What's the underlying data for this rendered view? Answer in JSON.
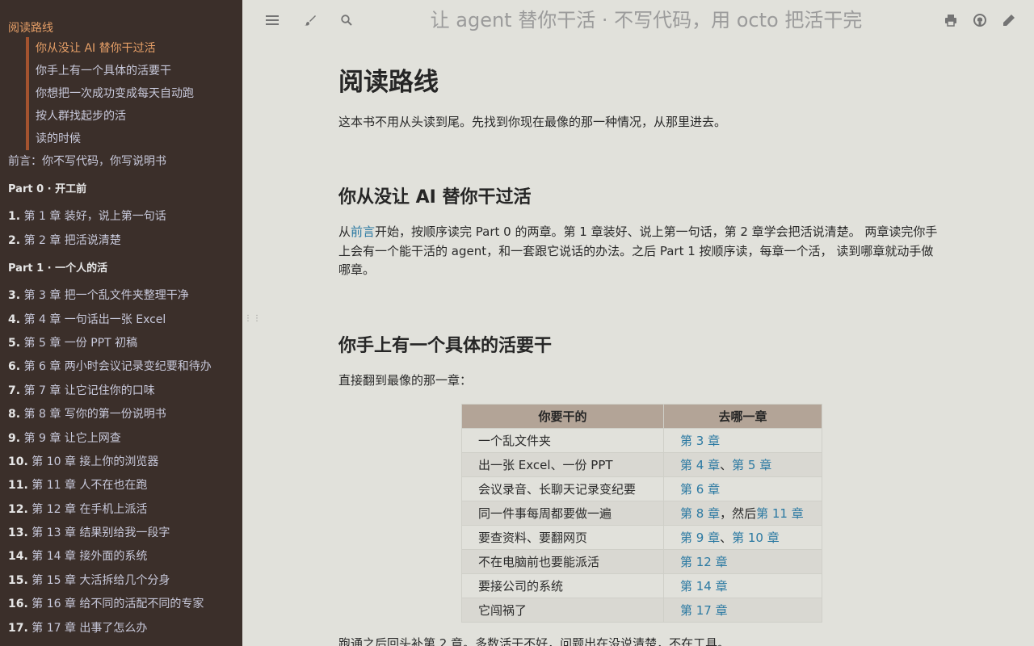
{
  "sidebar": {
    "active_label": "阅读路线",
    "sub_items": [
      "你从没让 AI 替你干过活",
      "你手上有一个具体的活要干",
      "你想把一次成功变成每天自动跑",
      "按人群找起步的活",
      "读的时候"
    ],
    "preface": "前言：你不写代码，你写说明书",
    "part0": "Part 0 · 开工前",
    "chapters_a": [
      {
        "num": "1.",
        "title": "第 1 章 装好，说上第一句话"
      },
      {
        "num": "2.",
        "title": "第 2 章 把活说清楚"
      }
    ],
    "part1": "Part 1 · 一个人的活",
    "chapters_b": [
      {
        "num": "3.",
        "title": "第 3 章 把一个乱文件夹整理干净"
      },
      {
        "num": "4.",
        "title": "第 4 章 一句话出一张 Excel"
      },
      {
        "num": "5.",
        "title": "第 5 章 一份 PPT 初稿"
      },
      {
        "num": "6.",
        "title": "第 6 章 两小时会议记录变纪要和待办"
      },
      {
        "num": "7.",
        "title": "第 7 章 让它记住你的口味"
      },
      {
        "num": "8.",
        "title": "第 8 章 写你的第一份说明书"
      },
      {
        "num": "9.",
        "title": "第 9 章 让它上网查"
      },
      {
        "num": "10.",
        "title": "第 10 章 接上你的浏览器"
      },
      {
        "num": "11.",
        "title": "第 11 章 人不在也在跑"
      },
      {
        "num": "12.",
        "title": "第 12 章 在手机上派活"
      },
      {
        "num": "13.",
        "title": "第 13 章 结果别给我一段字"
      },
      {
        "num": "14.",
        "title": "第 14 章 接外面的系统"
      },
      {
        "num": "15.",
        "title": "第 15 章 大活拆给几个分身"
      },
      {
        "num": "16.",
        "title": "第 16 章 给不同的活配不同的专家"
      },
      {
        "num": "17.",
        "title": "第 17 章 出事了怎么办"
      }
    ]
  },
  "topbar": {
    "title": "让 agent 替你干活 · 不写代码，用 octo 把活干完"
  },
  "content": {
    "h1": "阅读路线",
    "intro": "这本书不用从头读到尾。先找到你现在最像的那一种情况，从那里进去。",
    "sec1_title": "你从没让 AI 替你干过活",
    "sec1_p_pre": "从",
    "sec1_p_link": "前言",
    "sec1_p_post": "开始，按顺序读完 Part 0 的两章。第 1 章装好、说上第一句话，第 2 章学会把活说清楚。 两章读完你手上会有一个能干活的 agent，和一套跟它说话的办法。之后 Part 1 按顺序读，每章一个活， 读到哪章就动手做哪章。",
    "sec2_title": "你手上有一个具体的活要干",
    "sec2_p": "直接翻到最像的那一章：",
    "table": {
      "headers": [
        "你要干的",
        "去哪一章"
      ],
      "rows": [
        {
          "task": "一个乱文件夹",
          "links": [
            "第 3 章"
          ],
          "sep": [],
          "tail": ""
        },
        {
          "task": "出一张 Excel、一份 PPT",
          "links": [
            "第 4 章",
            "第 5 章"
          ],
          "sep": [
            "、"
          ],
          "tail": ""
        },
        {
          "task": "会议录音、长聊天记录变纪要",
          "links": [
            "第 6 章"
          ],
          "sep": [],
          "tail": ""
        },
        {
          "task": "同一件事每周都要做一遍",
          "links": [
            "第 8 章",
            "第 11 章"
          ],
          "sep": [
            "，然后"
          ],
          "tail": ""
        },
        {
          "task": "要查资料、要翻网页",
          "links": [
            "第 9 章",
            "第 10 章"
          ],
          "sep": [
            "、"
          ],
          "tail": ""
        },
        {
          "task": "不在电脑前也要能派活",
          "links": [
            "第 12 章"
          ],
          "sep": [],
          "tail": ""
        },
        {
          "task": "要接公司的系统",
          "links": [
            "第 14 章"
          ],
          "sep": [],
          "tail": ""
        },
        {
          "task": "它闯祸了",
          "links": [
            "第 17 章"
          ],
          "sep": [],
          "tail": ""
        }
      ]
    },
    "after_table": "跑通之后回头补第 2 章。多数活干不好，问题出在没说清楚，不在工具。"
  },
  "icons": {
    "menu": "menu-icon",
    "theme": "paintbrush-icon",
    "search": "search-icon",
    "print": "print-icon",
    "github": "github-icon",
    "edit": "edit-icon"
  },
  "colors": {
    "sidebar_bg": "#3b2f2a",
    "sidebar_active": "#e69f67",
    "sidebar_text": "#c8c9db",
    "content_bg": "#e1e1db",
    "link": "#2b79a2",
    "table_header": "#b3a497"
  }
}
